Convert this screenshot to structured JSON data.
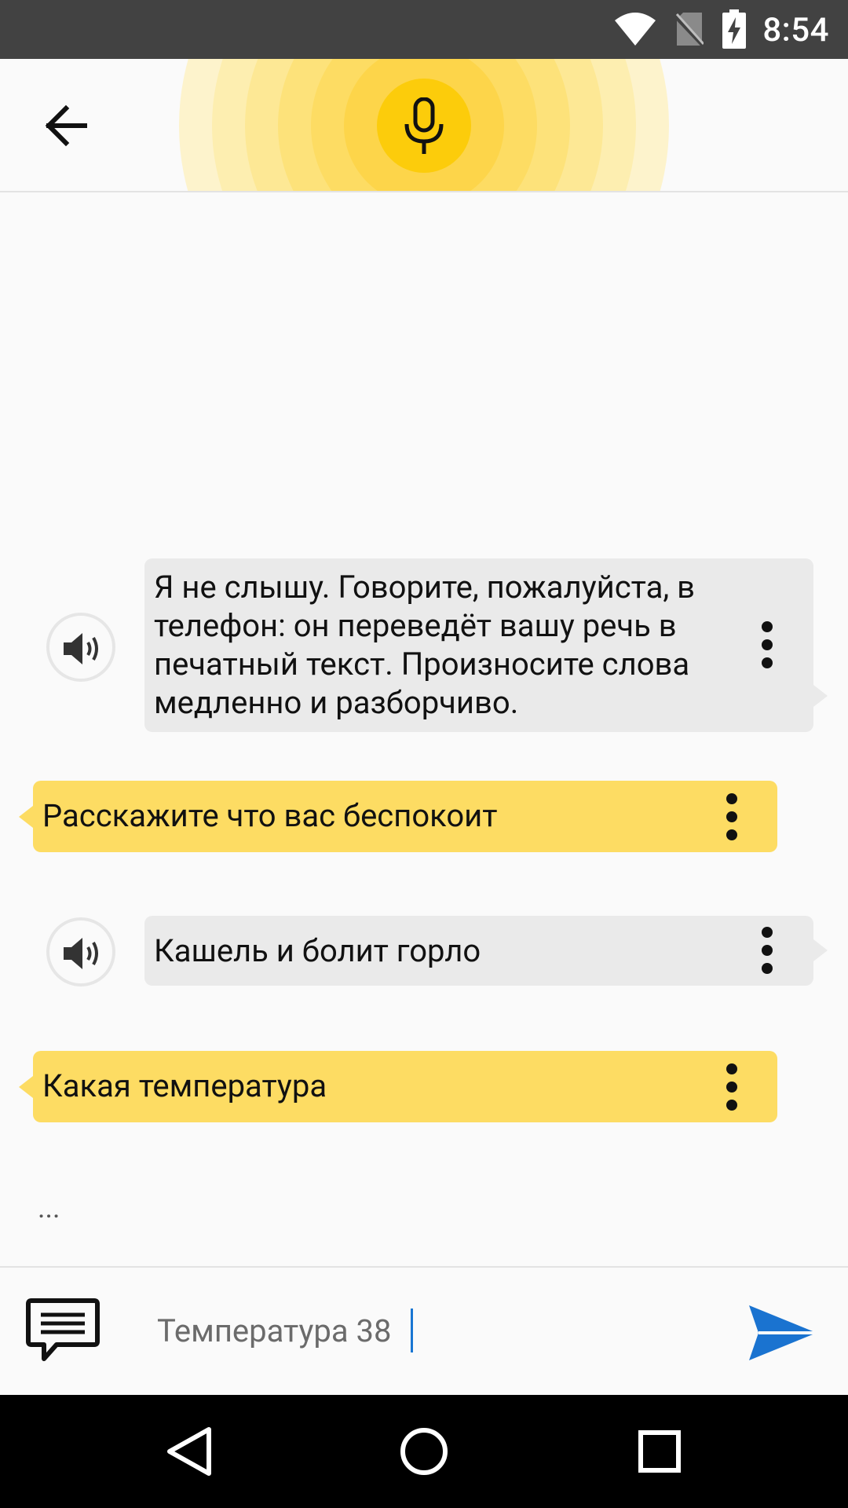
{
  "status_bar": {
    "time": "8:54",
    "icons": [
      "wifi-icon",
      "no-sim-icon",
      "battery-charging-icon"
    ]
  },
  "header": {
    "back_icon": "arrow-left-icon",
    "mic_icon": "microphone-icon",
    "accent_color": "#fccc0b"
  },
  "messages": [
    {
      "sender": "user",
      "text": "Я не слышу. Говорите,  пожалуйста, в телефон: он переведёт вашу речь в печатный текст. Произносите слова медленно и разборчиво.",
      "lines": [
        "Я не слышу. Говорите,  пожалуйста, в",
        "телефон: он переведёт вашу речь в",
        "печатный текст. Произносите слова",
        "медленно и разборчиво."
      ]
    },
    {
      "sender": "assistant",
      "text": "Расскажите что вас беспокоит"
    },
    {
      "sender": "user",
      "text": "Кашель и болит горло"
    },
    {
      "sender": "assistant",
      "text": "Какая температура"
    }
  ],
  "typing_indicator": "...",
  "input": {
    "value": "Температура 38",
    "keyboard_icon": "chat-bubble-icon",
    "send_icon": "send-icon"
  },
  "nav_bar": {
    "buttons": [
      "back-triangle-icon",
      "home-circle-icon",
      "recents-square-icon"
    ]
  },
  "colors": {
    "assistant_bubble": "#fddc63",
    "user_bubble": "#eaeaea",
    "send": "#1a73d0",
    "status_bar": "#424242"
  }
}
